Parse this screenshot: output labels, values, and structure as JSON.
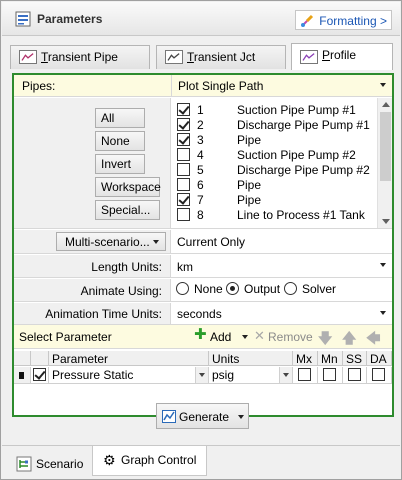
{
  "header": {
    "title": "Parameters",
    "formatting_label": "Formatting >"
  },
  "tabs": [
    {
      "label": "Transient Pipe",
      "underline": "T",
      "rest": "ransient Pipe"
    },
    {
      "label": "Transient Jct",
      "underline": "T",
      "rest": "ransient Jct"
    },
    {
      "label": "Profile",
      "underline": "P",
      "rest": "rofile",
      "active": true
    }
  ],
  "pipes": {
    "label": "Pipes:",
    "mode_value": "Plot Single Path",
    "buttons": [
      "All",
      "None",
      "Invert",
      "Workspace",
      "Special..."
    ],
    "items": [
      {
        "num": "1",
        "name": "Suction Pipe Pump #1",
        "checked": true
      },
      {
        "num": "2",
        "name": "Discharge Pipe Pump #1",
        "checked": true
      },
      {
        "num": "3",
        "name": "Pipe",
        "checked": true
      },
      {
        "num": "4",
        "name": "Suction Pipe Pump #2",
        "checked": false
      },
      {
        "num": "5",
        "name": "Discharge Pipe Pump #2",
        "checked": false
      },
      {
        "num": "6",
        "name": "Pipe",
        "checked": false
      },
      {
        "num": "7",
        "name": "Pipe",
        "checked": true
      },
      {
        "num": "8",
        "name": "Line to Process #1 Tank",
        "checked": false
      }
    ]
  },
  "scenario": {
    "button_label": "Multi-scenario...",
    "value": "Current Only"
  },
  "length_units": {
    "label": "Length Units:",
    "value": "km"
  },
  "animate": {
    "label": "Animate Using:",
    "options": [
      "None",
      "Output",
      "Solver"
    ],
    "selected": "Output"
  },
  "animation_time_units": {
    "label": "Animation Time Units:",
    "value": "seconds"
  },
  "select_parameter": {
    "title": "Select Parameter",
    "add_label": "Add",
    "remove_label": "Remove"
  },
  "grid": {
    "columns": [
      "Parameter",
      "Units",
      "Mx",
      "Mn",
      "SS",
      "DA"
    ],
    "row": {
      "parameter": "Pressure Static",
      "units": "psig",
      "checked": true
    }
  },
  "generate_label": "Generate",
  "bottom_tabs": [
    {
      "label": "Scenario"
    },
    {
      "label": "Graph Control",
      "active": true
    }
  ],
  "colors": {
    "accent_green": "#2e8b2e",
    "link_blue": "#1a56b4",
    "highlight_yellow": "#fdfbe0"
  }
}
